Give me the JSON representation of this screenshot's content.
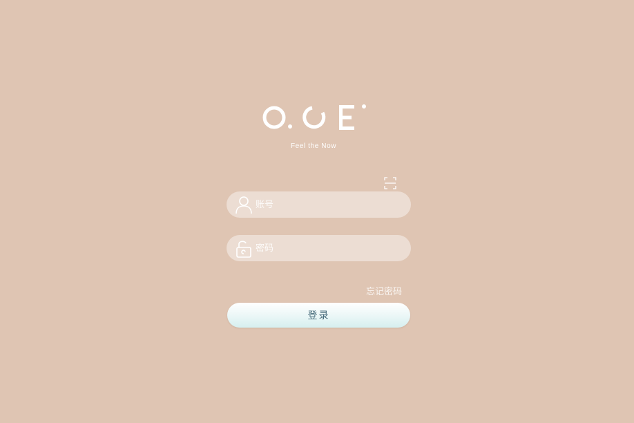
{
  "brand": {
    "tagline": "Feel the Now"
  },
  "icons": {
    "scan": "scan-icon",
    "user": "user-icon",
    "lock": "unlock-icon"
  },
  "form": {
    "username_placeholder": "账号",
    "password_placeholder": "密码",
    "forgot_label": "忘记密码",
    "login_label": "登录"
  },
  "colors": {
    "background": "#dfc5b3",
    "button_text": "#466a7a",
    "button_gradient_end": "#d6efef"
  }
}
